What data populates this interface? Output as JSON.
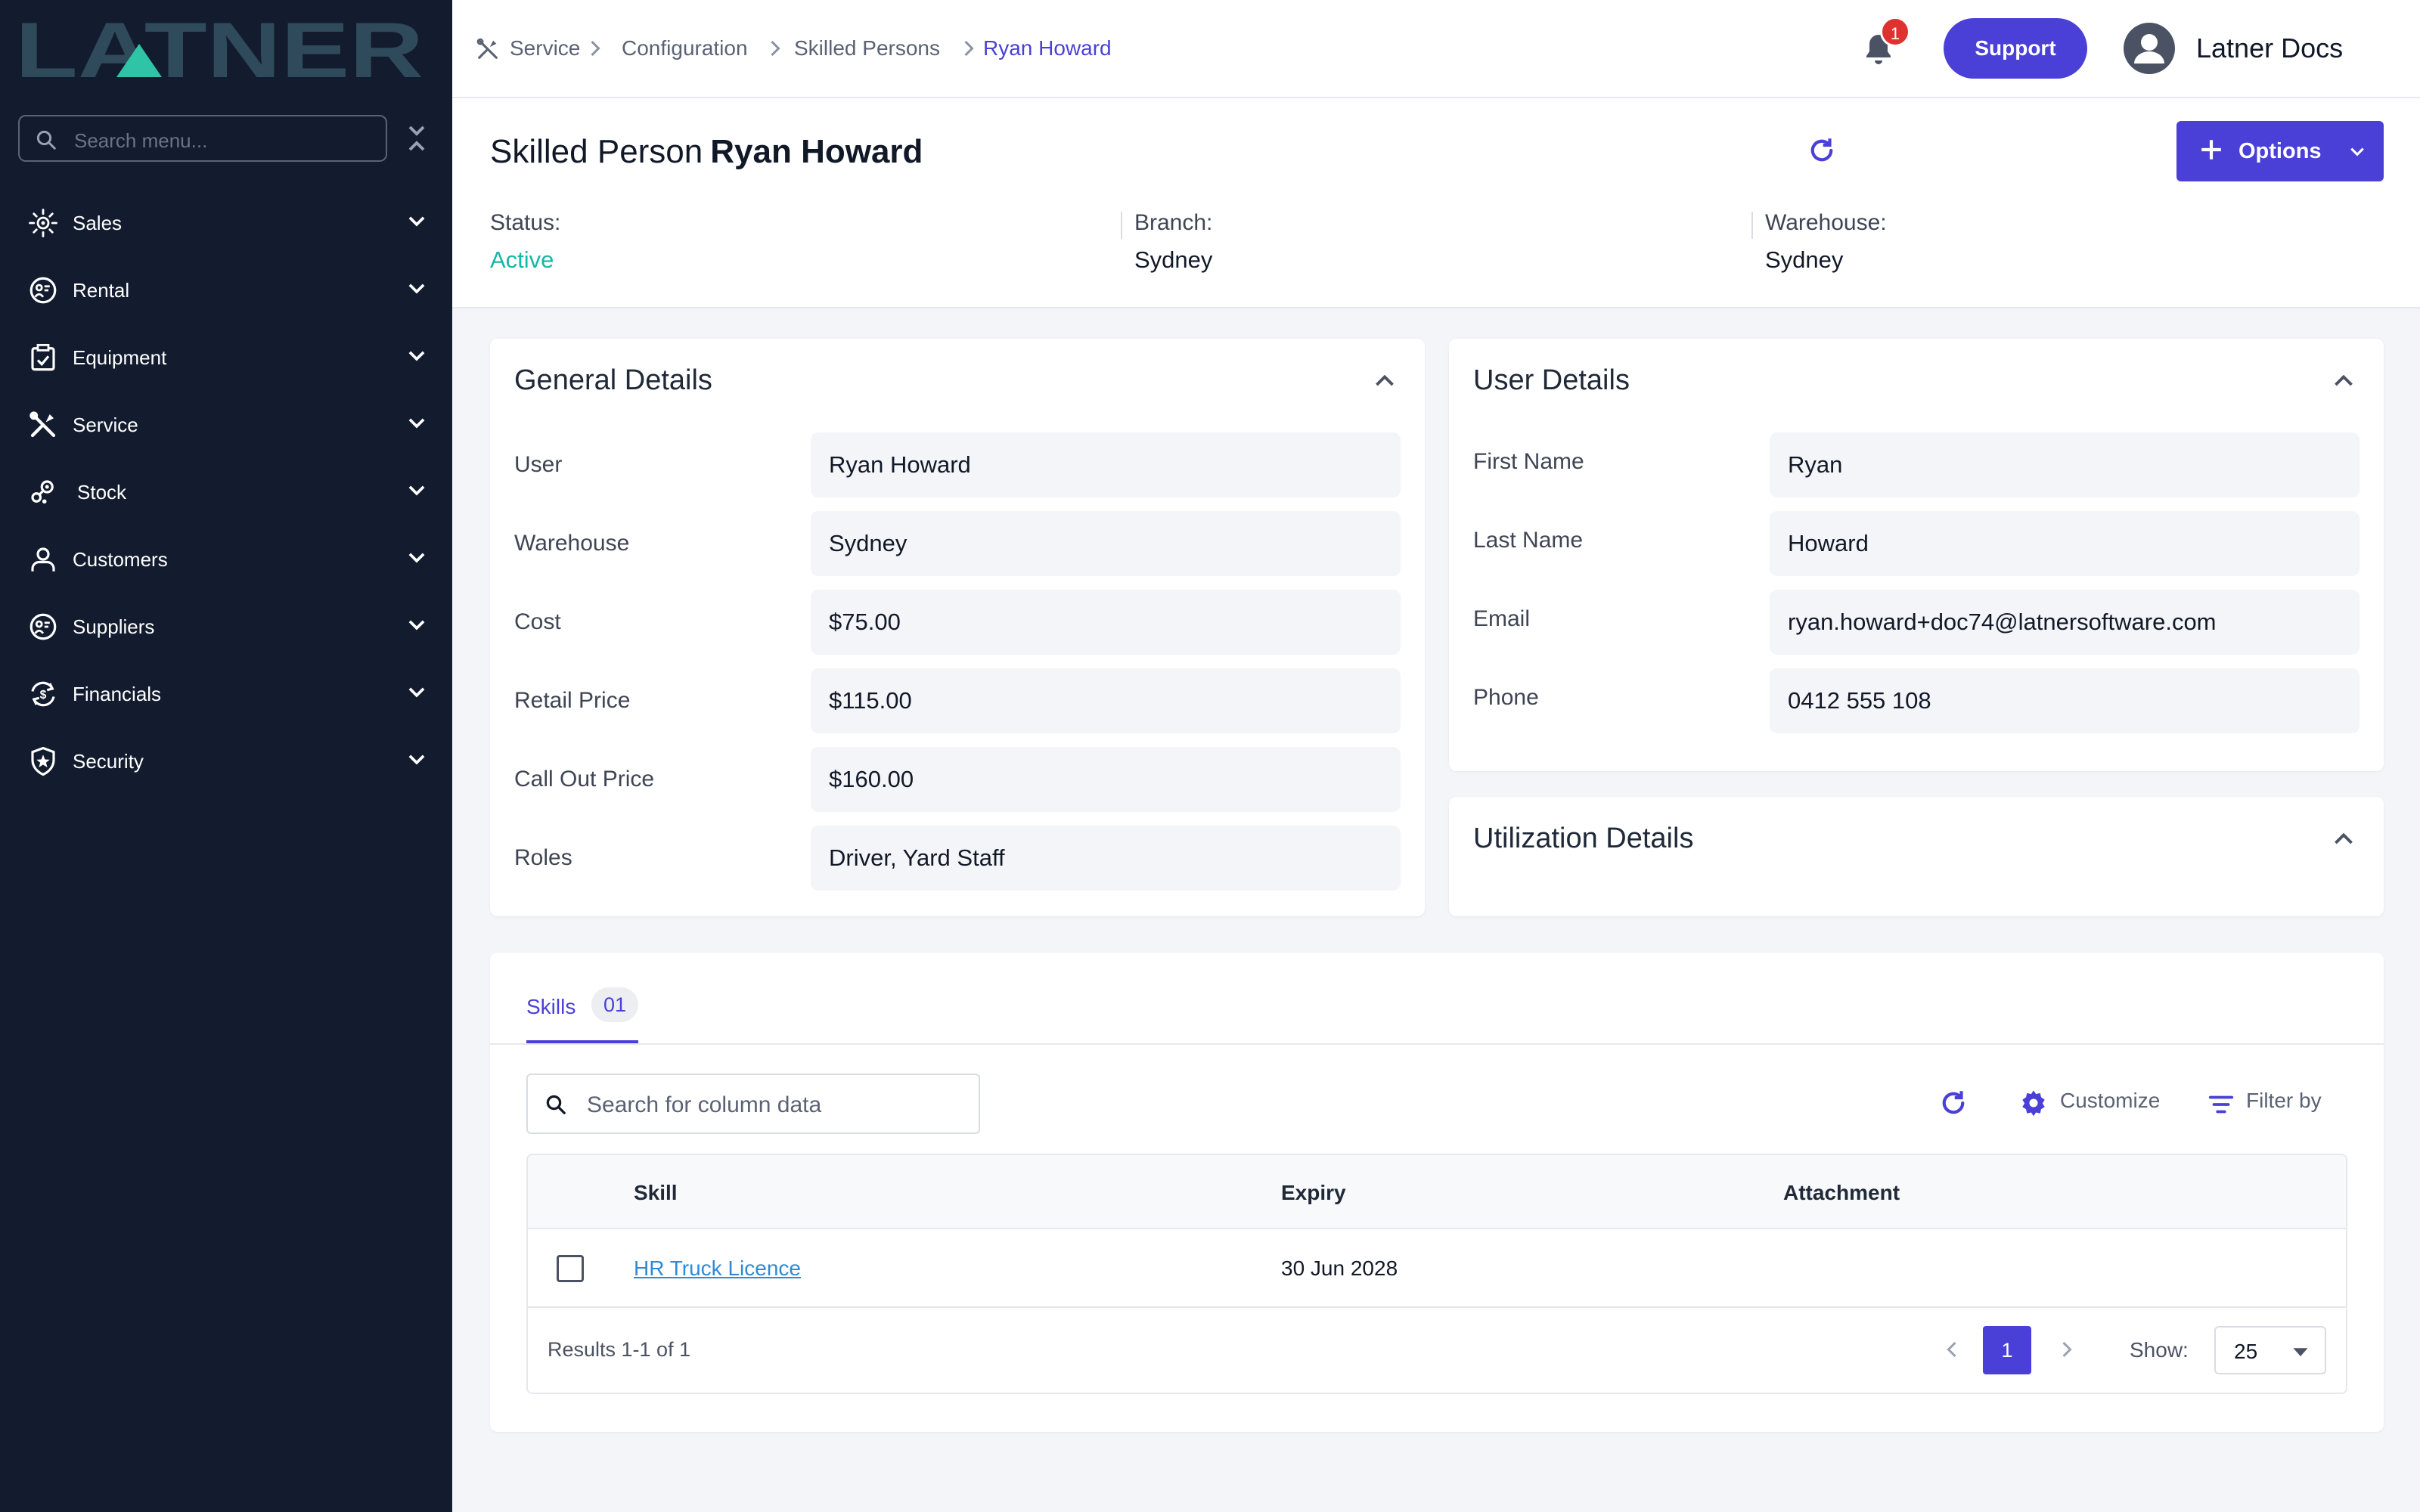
{
  "brand": {
    "logo_text": "LATNER"
  },
  "sidebar": {
    "search_placeholder": "Search menu...",
    "items": [
      {
        "label": "Sales",
        "icon": "sales-icon"
      },
      {
        "label": "Rental",
        "icon": "rental-icon"
      },
      {
        "label": "Equipment",
        "icon": "equipment-icon"
      },
      {
        "label": "Service",
        "icon": "service-icon"
      },
      {
        "label": "Stock",
        "icon": "stock-icon"
      },
      {
        "label": "Customers",
        "icon": "customers-icon"
      },
      {
        "label": "Suppliers",
        "icon": "suppliers-icon"
      },
      {
        "label": "Financials",
        "icon": "financials-icon"
      },
      {
        "label": "Security",
        "icon": "security-icon"
      }
    ]
  },
  "topbar": {
    "breadcrumb": [
      "Service",
      "Configuration",
      "Skilled Persons",
      "Ryan Howard"
    ],
    "notification_count": "1",
    "support_label": "Support",
    "user_name": "Latner Docs"
  },
  "header": {
    "title_prefix": "Skilled Person",
    "title_name": "Ryan Howard",
    "options_label": "Options",
    "status_label": "Status:",
    "status_value": "Active",
    "branch_label": "Branch:",
    "branch_value": "Sydney",
    "warehouse_label": "Warehouse:",
    "warehouse_value": "Sydney"
  },
  "general_details": {
    "title": "General Details",
    "fields": [
      {
        "label": "User",
        "value": "Ryan Howard"
      },
      {
        "label": "Warehouse",
        "value": "Sydney"
      },
      {
        "label": "Cost",
        "value": "$75.00"
      },
      {
        "label": "Retail Price",
        "value": "$115.00"
      },
      {
        "label": "Call Out Price",
        "value": "$160.00"
      },
      {
        "label": "Roles",
        "value": "Driver, Yard Staff"
      }
    ]
  },
  "user_details": {
    "title": "User Details",
    "fields": [
      {
        "label": "First Name",
        "value": "Ryan"
      },
      {
        "label": "Last Name",
        "value": "Howard"
      },
      {
        "label": "Email",
        "value": "ryan.howard+doc74@latnersoftware.com"
      },
      {
        "label": "Phone",
        "value": "0412 555 108"
      }
    ]
  },
  "utilization_details": {
    "title": "Utilization Details"
  },
  "skills": {
    "tab_label": "Skills",
    "tab_count": "01",
    "search_placeholder": "Search for column data",
    "customize_label": "Customize",
    "filter_label": "Filter by",
    "columns": [
      "Skill",
      "Expiry",
      "Attachment"
    ],
    "rows": [
      {
        "skill": "HR Truck Licence",
        "expiry": "30 Jun 2028",
        "attachment": ""
      }
    ],
    "results_text": "Results 1-1 of 1",
    "current_page": "1",
    "show_label": "Show:",
    "page_size": "25"
  },
  "colors": {
    "accent": "#4a40d8",
    "sidebar_bg": "#131c2f",
    "status_active": "#14b8a6",
    "badge": "#e03131",
    "logo": "#2f4a5a",
    "logo_triangle": "#2ec4a5"
  }
}
